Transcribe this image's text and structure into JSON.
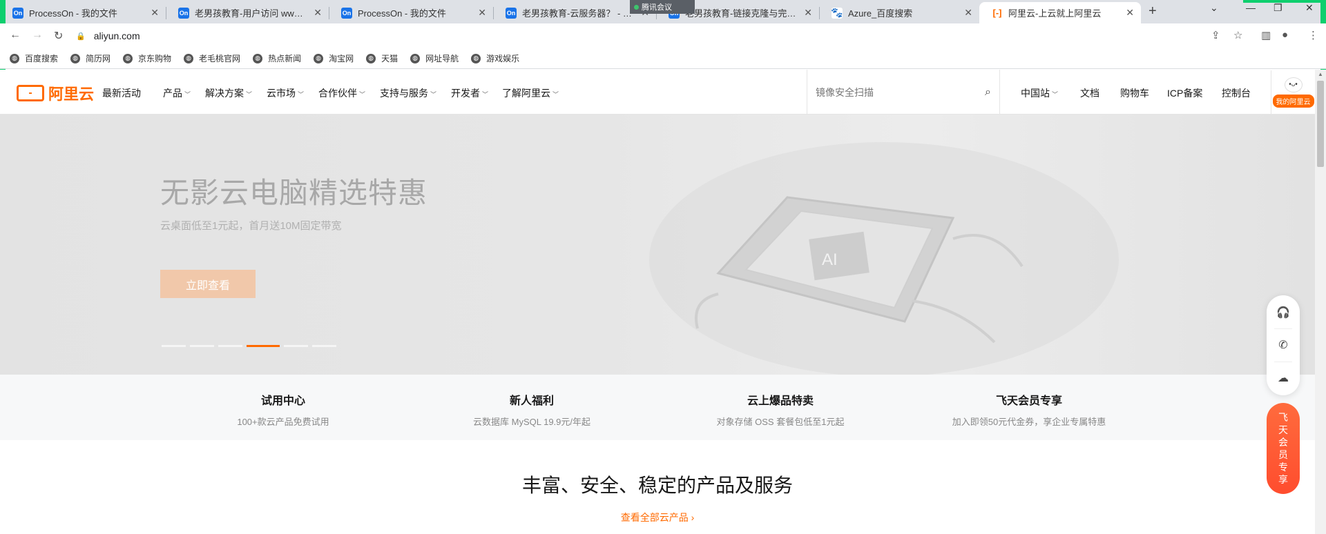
{
  "browser": {
    "tabs": [
      {
        "title": "ProcessOn - 我的文件",
        "icon": "processon-icon",
        "icon_text": "On"
      },
      {
        "title": "老男孩教育-用户访问 www.oldb",
        "icon": "processon-icon",
        "icon_text": "On"
      },
      {
        "title": "ProcessOn - 我的文件",
        "icon": "processon-icon",
        "icon_text": "On"
      },
      {
        "title": "老男孩教育-云服务器？ - Proc",
        "icon": "processon-icon",
        "icon_text": "On"
      },
      {
        "title": "老男孩教育-链接克隆与完整克隆",
        "icon": "processon-icon",
        "icon_text": "On"
      },
      {
        "title": "Azure_百度搜索",
        "icon": "baidu-icon",
        "icon_text": "🐾"
      },
      {
        "title": "阿里云-上云就上阿里云",
        "icon": "aliyun-icon",
        "icon_text": "[-]",
        "active": true
      }
    ],
    "meeting_label": "腾讯会议",
    "url": "aliyun.com",
    "bookmarks": [
      "百度搜索",
      "简历网",
      "京东购物",
      "老毛桃官网",
      "热点新闻",
      "淘宝网",
      "天猫",
      "网址导航",
      "游戏娱乐"
    ]
  },
  "site": {
    "logo_text": "阿里云",
    "menu": [
      {
        "label": "最新活动",
        "dropdown": false
      },
      {
        "label": "产品",
        "dropdown": true
      },
      {
        "label": "解决方案",
        "dropdown": true
      },
      {
        "label": "云市场",
        "dropdown": true
      },
      {
        "label": "合作伙伴",
        "dropdown": true
      },
      {
        "label": "支持与服务",
        "dropdown": true
      },
      {
        "label": "开发者",
        "dropdown": true
      },
      {
        "label": "了解阿里云",
        "dropdown": true
      }
    ],
    "search_placeholder": "镜像安全扫描",
    "right_links": [
      {
        "label": "中国站",
        "dropdown": true
      },
      {
        "label": "文档"
      },
      {
        "label": "购物车"
      },
      {
        "label": "ICP备案"
      },
      {
        "label": "控制台"
      }
    ],
    "my_aliyun": "我的阿里云"
  },
  "hero": {
    "title": "无影云电脑精选特惠",
    "subtitle": "云桌面低至1元起，首月送10M固定带宽",
    "cta": "立即查看",
    "slide_count": 6,
    "active_slide": 4,
    "chip_text": "AI"
  },
  "promos": [
    {
      "title": "试用中心",
      "desc": "100+款云产品免费试用"
    },
    {
      "title": "新人福利",
      "desc": "云数据库 MySQL 19.9元/年起"
    },
    {
      "title": "云上爆品特卖",
      "desc": "对象存储 OSS 套餐包低至1元起"
    },
    {
      "title": "飞天会员专享",
      "desc": "加入即领50元代金券，享企业专属特惠"
    }
  ],
  "section": {
    "title": "丰富、安全、稳定的产品及服务",
    "view_all": "查看全部云产品"
  },
  "float_tools": [
    "customer-service-icon",
    "phone-icon",
    "cloud-icon"
  ],
  "vip_label": "飞天会员专享",
  "colors": {
    "accent": "#ff6a00",
    "tab_bg": "#dee1e6",
    "green_frame": "#0ecf6e"
  }
}
